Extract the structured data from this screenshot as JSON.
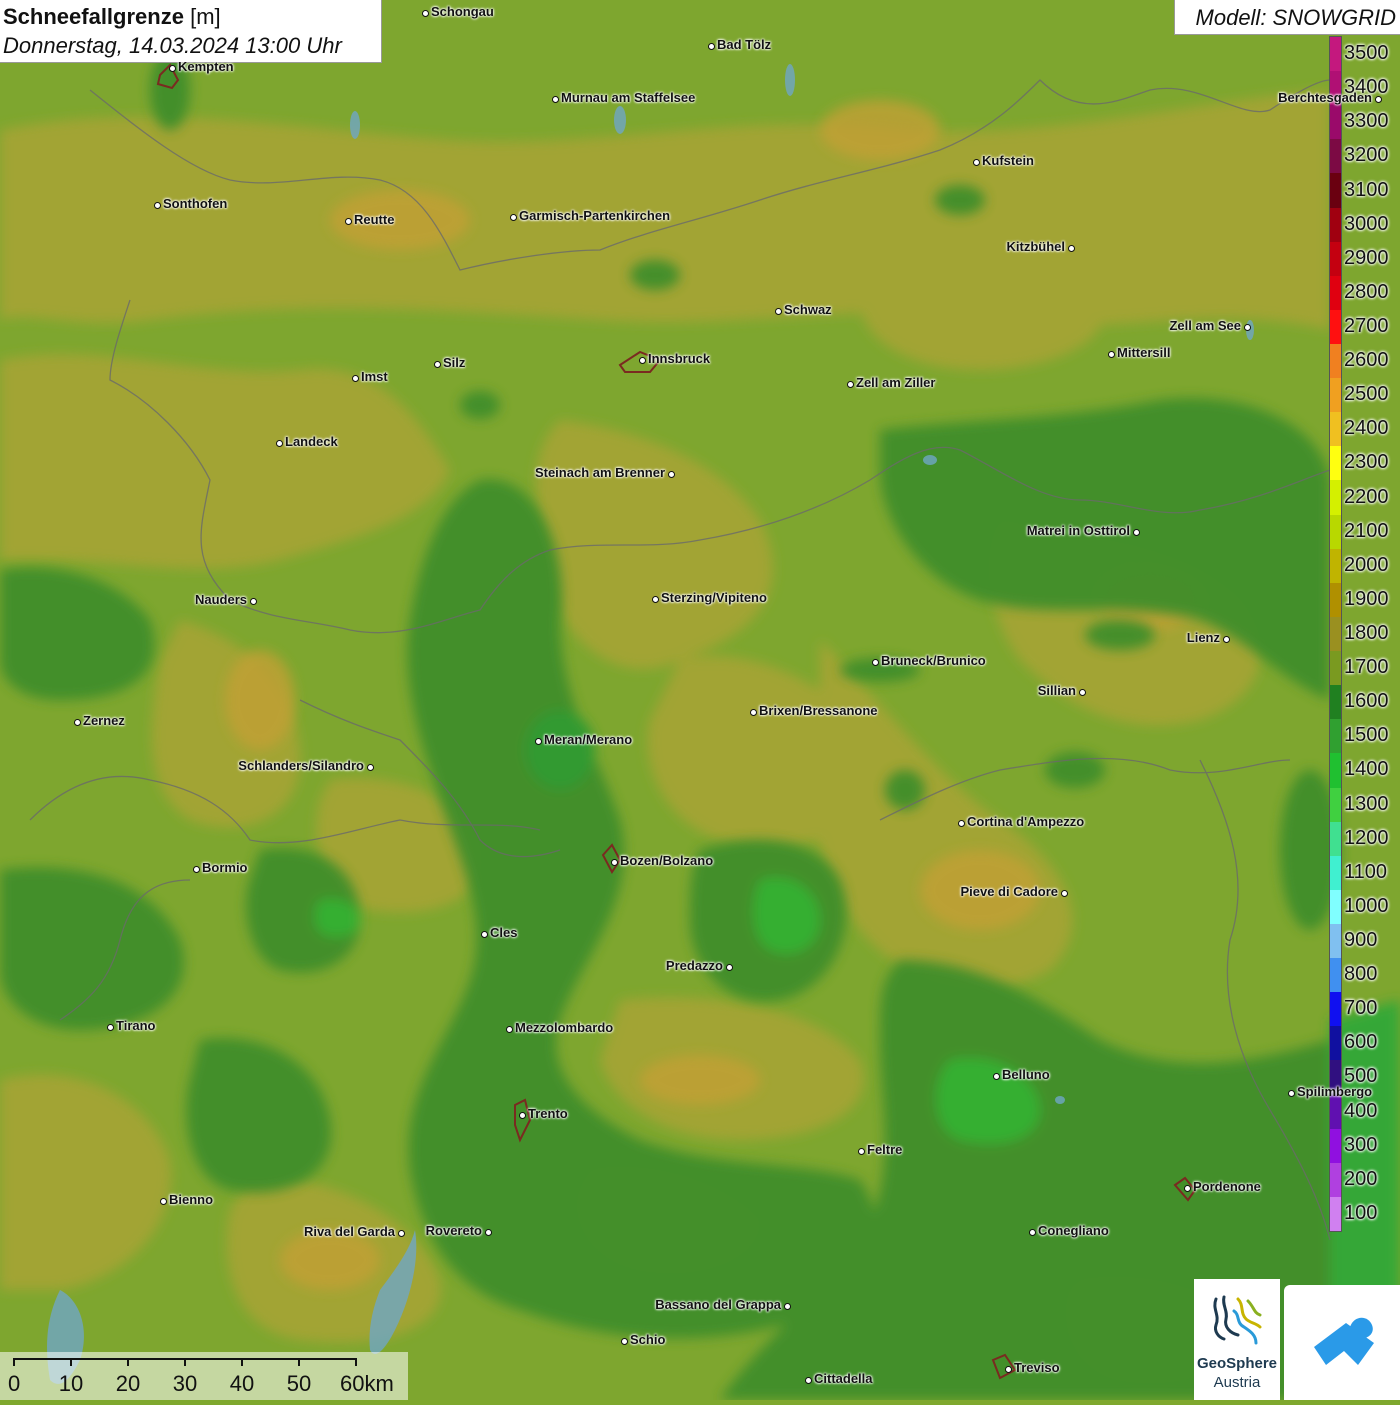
{
  "title": {
    "name": "Schneefallgrenze",
    "unit": "[m]",
    "datetime": "Donnerstag, 14.03.2024 13:00 Uhr"
  },
  "model": "Modell: SNOWGRID",
  "legend": {
    "labels": [
      "3500",
      "3400",
      "3300",
      "3200",
      "3100",
      "3000",
      "2900",
      "2800",
      "2700",
      "2600",
      "2500",
      "2400",
      "2300",
      "2200",
      "2100",
      "2000",
      "1900",
      "1800",
      "1700",
      "1600",
      "1500",
      "1400",
      "1300",
      "1200",
      "1100",
      "1000",
      "900",
      "800",
      "700",
      "600",
      "500",
      "400",
      "300",
      "200",
      "100"
    ],
    "colors": [
      "#c4187e",
      "#b01074",
      "#9a0a6a",
      "#7c0a44",
      "#6a0010",
      "#a00010",
      "#c40010",
      "#e00010",
      "#ff1010",
      "#f08020",
      "#f0a020",
      "#f0c020",
      "#ffff10",
      "#d4f000",
      "#b8d800",
      "#c0b400",
      "#b09000",
      "#9a9020",
      "#7a9a20",
      "#208020",
      "#30a030",
      "#20c030",
      "#40d040",
      "#40e090",
      "#40f0d0",
      "#80ffff",
      "#80c0f0",
      "#4090f0",
      "#1010f0",
      "#1010a0",
      "#301080",
      "#6010b0",
      "#9010e0",
      "#b040e0",
      "#d080f0"
    ]
  },
  "cities": [
    {
      "name": "Schongau",
      "side": "right"
    },
    {
      "name": "Bad Tölz",
      "side": "right"
    },
    {
      "name": "Kempten",
      "side": "right"
    },
    {
      "name": "Murnau am Staffelsee",
      "side": "right"
    },
    {
      "name": "Berchtesgaden",
      "side": "left"
    },
    {
      "name": "Kufstein",
      "side": "right"
    },
    {
      "name": "Sonthofen",
      "side": "right"
    },
    {
      "name": "Reutte",
      "side": "right"
    },
    {
      "name": "Garmisch-Partenkirchen",
      "side": "right"
    },
    {
      "name": "Kitzbühel",
      "side": "left"
    },
    {
      "name": "Schwaz",
      "side": "right"
    },
    {
      "name": "Zell am See",
      "side": "left"
    },
    {
      "name": "Mittersill",
      "side": "right"
    },
    {
      "name": "Innsbruck",
      "side": "right"
    },
    {
      "name": "Silz",
      "side": "right"
    },
    {
      "name": "Imst",
      "side": "right"
    },
    {
      "name": "Zell am Ziller",
      "side": "right"
    },
    {
      "name": "Landeck",
      "side": "right"
    },
    {
      "name": "Steinach am Brenner",
      "side": "left"
    },
    {
      "name": "Matrei in Osttirol",
      "side": "left"
    },
    {
      "name": "Nauders",
      "side": "left"
    },
    {
      "name": "Sterzing/Vipiteno",
      "side": "right"
    },
    {
      "name": "Lienz",
      "side": "left"
    },
    {
      "name": "Bruneck/Brunico",
      "side": "right"
    },
    {
      "name": "Sillian",
      "side": "left"
    },
    {
      "name": "Brixen/Bressanone",
      "side": "right"
    },
    {
      "name": "Zernez",
      "side": "right"
    },
    {
      "name": "Meran/Merano",
      "side": "right"
    },
    {
      "name": "Schlanders/Silandro",
      "side": "left"
    },
    {
      "name": "Cortina d'Ampezzo",
      "side": "right"
    },
    {
      "name": "Bozen/Bolzano",
      "side": "right"
    },
    {
      "name": "Bormio",
      "side": "right"
    },
    {
      "name": "Pieve di Cadore",
      "side": "left"
    },
    {
      "name": "Cles",
      "side": "right"
    },
    {
      "name": "Predazzo",
      "side": "left"
    },
    {
      "name": "Tirano",
      "side": "right"
    },
    {
      "name": "Mezzolombardo",
      "side": "right"
    },
    {
      "name": "Belluno",
      "side": "right"
    },
    {
      "name": "Spilimbergo",
      "side": "right"
    },
    {
      "name": "Trento",
      "side": "right"
    },
    {
      "name": "Feltre",
      "side": "right"
    },
    {
      "name": "Pordenone",
      "side": "right"
    },
    {
      "name": "Bienno",
      "side": "right"
    },
    {
      "name": "Riva del Garda",
      "side": "left"
    },
    {
      "name": "Rovereto",
      "side": "left"
    },
    {
      "name": "Conegliano",
      "side": "right"
    },
    {
      "name": "Bassano del Grappa",
      "side": "left"
    },
    {
      "name": "Schio",
      "side": "right"
    },
    {
      "name": "Treviso",
      "side": "right"
    },
    {
      "name": "Cittadella",
      "side": "right"
    }
  ],
  "scale": {
    "labels": [
      "0",
      "10",
      "20",
      "30",
      "40",
      "50",
      "60km"
    ]
  },
  "logos": {
    "geosphere_line1": "GeoSphere",
    "geosphere_line2": "Austria",
    "app_icon": "snow-app-icon"
  }
}
